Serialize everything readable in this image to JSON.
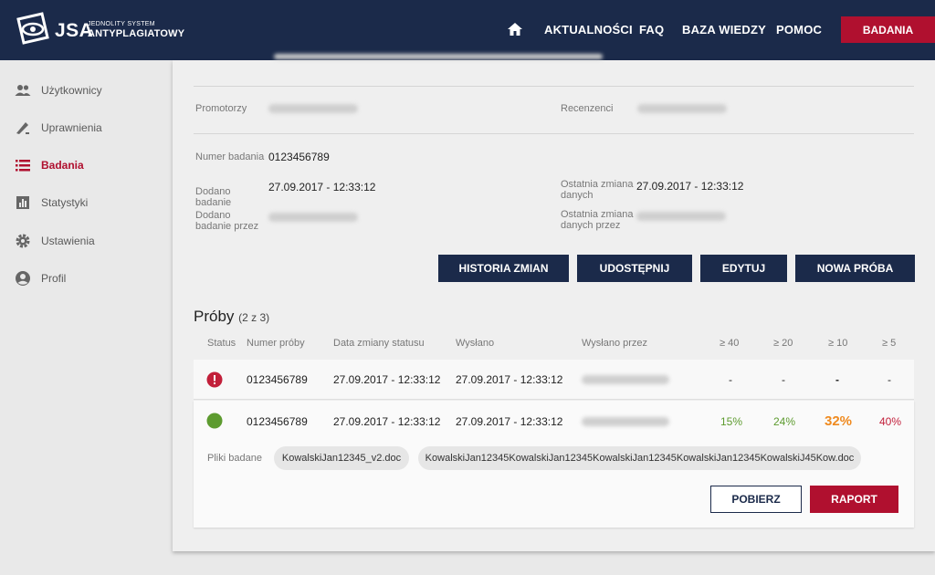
{
  "header": {
    "logo_text": "JSA",
    "logo_sub1": "JEDNOLITY SYSTEM",
    "logo_sub2": "ANTYPLAGIATOWY",
    "nav": [
      "AKTUALNOŚCI",
      "FAQ",
      "BAZA WIEDZY",
      "POMOC"
    ],
    "cta": "BADANIA"
  },
  "sidebar": {
    "items": [
      {
        "label": "Użytkownicy",
        "icon": "users-icon"
      },
      {
        "label": "Uprawnienia",
        "icon": "permissions-icon"
      },
      {
        "label": "Badania",
        "icon": "list-icon",
        "active": true
      },
      {
        "label": "Statystyki",
        "icon": "chart-icon"
      },
      {
        "label": "Ustawienia",
        "icon": "gear-icon"
      },
      {
        "label": "Profil",
        "icon": "profile-icon"
      }
    ]
  },
  "details": {
    "promotorzy_label": "Promotorzy",
    "recenzenci_label": "Recenzenci",
    "numer_label": "Numer badania",
    "numer_value": "0123456789",
    "dodano_label_1": "Dodano",
    "dodano_label_2": "badanie",
    "dodano_value": "27.09.2017 - 12:33:12",
    "dodano_przez_label_1": "Dodano",
    "dodano_przez_label_2": "badanie przez",
    "ostatnia_label_1": "Ostatnia zmiana",
    "ostatnia_label_2": "danych",
    "ostatnia_value": "27.09.2017 - 12:33:12",
    "ostatnia_przez_label_1": "Ostatnia zmiana",
    "ostatnia_przez_label_2": "danych przez"
  },
  "actions": {
    "historia": "HISTORIA ZMIAN",
    "udostepnij": "UDOSTĘPNIJ",
    "edytuj": "EDYTUJ",
    "nowa": "NOWA PRÓBA"
  },
  "proby": {
    "title": "Próby",
    "count": "(2 z 3)",
    "headers": [
      "Status",
      "Numer próby",
      "Data zmiany statusu",
      "Wysłano",
      "Wysłano przez",
      "≥ 40",
      "≥ 20",
      "≥ 10",
      "≥ 5"
    ],
    "rows": [
      {
        "status": "error",
        "numer": "0123456789",
        "data": "27.09.2017 - 12:33:12",
        "wyslano": "27.09.2017 - 12:33:12",
        "p40": "-",
        "p20": "-",
        "p10": "-",
        "p5": "-"
      },
      {
        "status": "ok",
        "numer": "0123456789",
        "data": "27.09.2017 - 12:33:12",
        "wyslano": "27.09.2017 - 12:33:12",
        "p40": "15%",
        "p20": "24%",
        "p10": "32%",
        "p5": "40%"
      }
    ],
    "pliki_label": "Pliki badane",
    "files": [
      "KowalskiJan12345_v2.doc",
      "KowalskiJan12345KowalskiJan12345KowalskiJan12345KowalskiJan12345KowalskiJ45Kow.doc"
    ],
    "pobierz": "POBIERZ",
    "raport": "RAPORT"
  },
  "colors": {
    "navy": "#1b2a4a",
    "red": "#b0102f",
    "green": "#5d9b2f",
    "orange": "#ef8a1f",
    "red_pct": "#c21f3a"
  }
}
